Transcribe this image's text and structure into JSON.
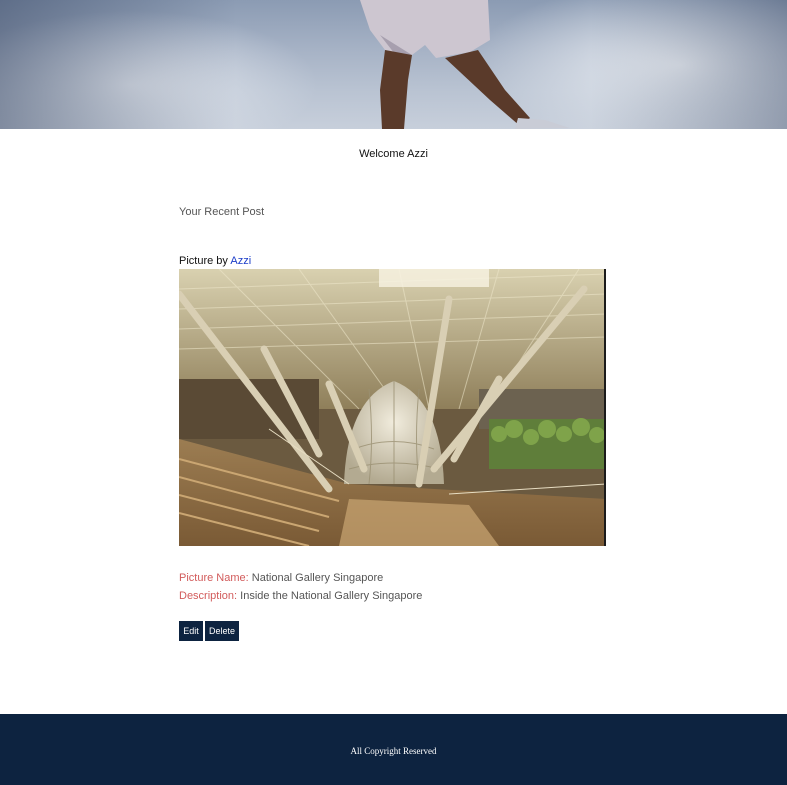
{
  "welcome": {
    "greeting": "Welcome Azzi"
  },
  "recent": {
    "title": "Your Recent Post"
  },
  "post": {
    "picture_by_label": "Picture by",
    "author": "Azzi",
    "name_key": "Picture Name:",
    "name_value": "National Gallery Singapore",
    "desc_key": "Description:",
    "desc_value": "Inside the National Gallery Singapore",
    "edit_label": "Edit",
    "delete_label": "Delete"
  },
  "footer": {
    "copyright": "All Copyright Reserved"
  },
  "colors": {
    "navy": "#0d2340",
    "label_red": "#d25b5b",
    "link_blue": "#1a3cc8"
  }
}
